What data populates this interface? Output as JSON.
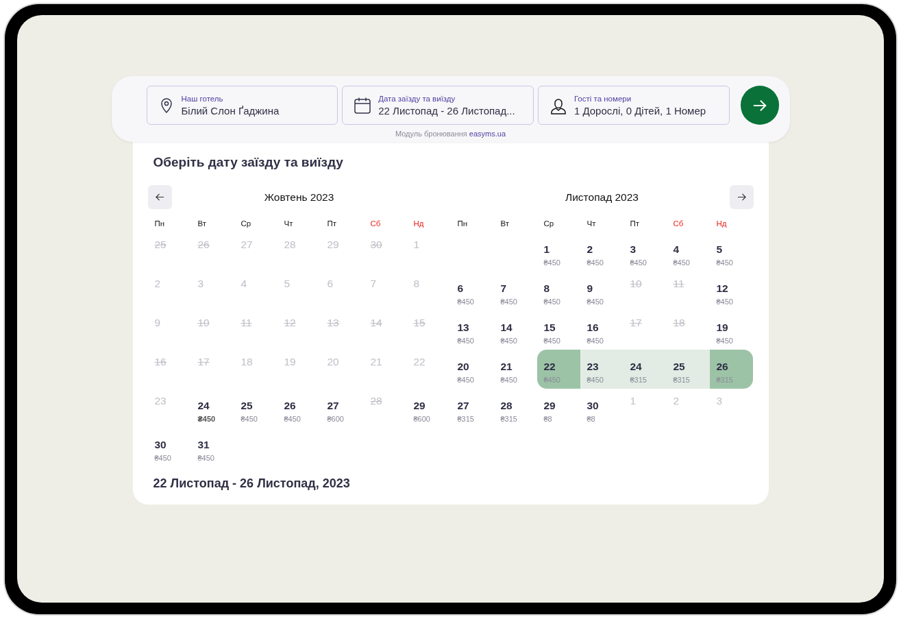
{
  "search_bar": {
    "fields": [
      {
        "kind": "hotel",
        "label": "Наш готель",
        "value": "Білий Слон Ґаджина"
      },
      {
        "kind": "dates",
        "label": "Дата заїзду та виїзду",
        "value": "22 Листопад - 26 Листопад..."
      },
      {
        "kind": "guests",
        "label": "Гості та номери",
        "value": "1 Дорослі, 0 Дітей, 1 Номер"
      }
    ],
    "powered_by": {
      "text": "Модуль бронювання",
      "link": "easyms.ua"
    }
  },
  "calendar": {
    "title": "Оберіть дату заїзду та виїзду",
    "months": [
      {
        "title": "Жовтень 2023",
        "weekdays": [
          {
            "label": "Пн",
            "weekend": false
          },
          {
            "label": "Вт",
            "weekend": false
          },
          {
            "label": "Ср",
            "weekend": false
          },
          {
            "label": "Чт",
            "weekend": false
          },
          {
            "label": "Пт",
            "weekend": false
          },
          {
            "label": "Сб",
            "weekend": true
          },
          {
            "label": "Нд",
            "weekend": true
          }
        ],
        "days": [
          {
            "day": "25",
            "kind": "closed"
          },
          {
            "day": "26",
            "kind": "closed"
          },
          {
            "day": "27",
            "kind": "inactive"
          },
          {
            "day": "28",
            "kind": "inactive"
          },
          {
            "day": "29",
            "kind": "inactive"
          },
          {
            "day": "30",
            "kind": "closed"
          },
          {
            "day": "1",
            "kind": "inactive"
          },
          {
            "day": "2",
            "kind": "inactive"
          },
          {
            "day": "3",
            "kind": "inactive"
          },
          {
            "day": "4",
            "kind": "inactive"
          },
          {
            "day": "5",
            "kind": "inactive"
          },
          {
            "day": "6",
            "kind": "inactive"
          },
          {
            "day": "7",
            "kind": "inactive"
          },
          {
            "day": "8",
            "kind": "inactive"
          },
          {
            "day": "9",
            "kind": "inactive"
          },
          {
            "day": "10",
            "kind": "closed"
          },
          {
            "day": "11",
            "kind": "closed"
          },
          {
            "day": "12",
            "kind": "closed"
          },
          {
            "day": "13",
            "kind": "closed"
          },
          {
            "day": "14",
            "kind": "closed"
          },
          {
            "day": "15",
            "kind": "closed"
          },
          {
            "day": "16",
            "kind": "closed"
          },
          {
            "day": "17",
            "kind": "closed"
          },
          {
            "day": "18",
            "kind": "inactive"
          },
          {
            "day": "19",
            "kind": "inactive"
          },
          {
            "day": "20",
            "kind": "inactive"
          },
          {
            "day": "21",
            "kind": "inactive"
          },
          {
            "day": "22",
            "kind": "inactive"
          },
          {
            "day": "23",
            "kind": "inactive"
          },
          {
            "day": "24",
            "kind": "today",
            "price": "₴450"
          },
          {
            "day": "25",
            "kind": "open",
            "price": "₴450"
          },
          {
            "day": "26",
            "kind": "open",
            "price": "₴450"
          },
          {
            "day": "27",
            "kind": "open",
            "price": "₴600"
          },
          {
            "day": "28",
            "kind": "closed"
          },
          {
            "day": "29",
            "kind": "open",
            "price": "₴600"
          },
          {
            "day": "30",
            "kind": "open",
            "price": "₴450"
          },
          {
            "day": "31",
            "kind": "open",
            "price": "₴450"
          }
        ]
      },
      {
        "title": "Листопад 2023",
        "weekdays": [
          {
            "label": "Пн",
            "weekend": false
          },
          {
            "label": "Вт",
            "weekend": false
          },
          {
            "label": "Ср",
            "weekend": false
          },
          {
            "label": "Чт",
            "weekend": false
          },
          {
            "label": "Пт",
            "weekend": false
          },
          {
            "label": "Сб",
            "weekend": true
          },
          {
            "label": "Нд",
            "weekend": true
          }
        ],
        "days": [
          {
            "kind": "blank"
          },
          {
            "kind": "blank"
          },
          {
            "day": "1",
            "kind": "open",
            "price": "₴450"
          },
          {
            "day": "2",
            "kind": "open",
            "price": "₴450"
          },
          {
            "day": "3",
            "kind": "open",
            "price": "₴450"
          },
          {
            "day": "4",
            "kind": "open",
            "price": "₴450"
          },
          {
            "day": "5",
            "kind": "open",
            "price": "₴450"
          },
          {
            "day": "6",
            "kind": "open",
            "price": "₴450"
          },
          {
            "day": "7",
            "kind": "open",
            "price": "₴450"
          },
          {
            "day": "8",
            "kind": "open",
            "price": "₴450"
          },
          {
            "day": "9",
            "kind": "open",
            "price": "₴450"
          },
          {
            "day": "10",
            "kind": "closed"
          },
          {
            "day": "11",
            "kind": "closed"
          },
          {
            "day": "12",
            "kind": "open",
            "price": "₴450"
          },
          {
            "day": "13",
            "kind": "open",
            "price": "₴450"
          },
          {
            "day": "14",
            "kind": "open",
            "price": "₴450"
          },
          {
            "day": "15",
            "kind": "open",
            "price": "₴450"
          },
          {
            "day": "16",
            "kind": "open",
            "price": "₴450"
          },
          {
            "day": "17",
            "kind": "closed"
          },
          {
            "day": "18",
            "kind": "closed"
          },
          {
            "day": "19",
            "kind": "open",
            "price": "₴450"
          },
          {
            "day": "20",
            "kind": "open",
            "price": "₴450"
          },
          {
            "day": "21",
            "kind": "open",
            "price": "₴450"
          },
          {
            "day": "22",
            "kind": "range-start",
            "price": "₴450"
          },
          {
            "day": "23",
            "kind": "in-range",
            "price": "₴450"
          },
          {
            "day": "24",
            "kind": "in-range",
            "price": "₴315"
          },
          {
            "day": "25",
            "kind": "in-range",
            "price": "₴315"
          },
          {
            "day": "26",
            "kind": "range-end",
            "price": "₴315"
          },
          {
            "day": "27",
            "kind": "open",
            "price": "₴315"
          },
          {
            "day": "28",
            "kind": "open",
            "price": "₴315"
          },
          {
            "day": "29",
            "kind": "open",
            "price": "₴8"
          },
          {
            "day": "30",
            "kind": "open",
            "price": "₴8"
          },
          {
            "day": "1",
            "kind": "inactive"
          },
          {
            "day": "2",
            "kind": "inactive"
          },
          {
            "day": "3",
            "kind": "inactive"
          }
        ]
      }
    ],
    "summary": "22 Листопад - 26 Листопад, 2023"
  }
}
